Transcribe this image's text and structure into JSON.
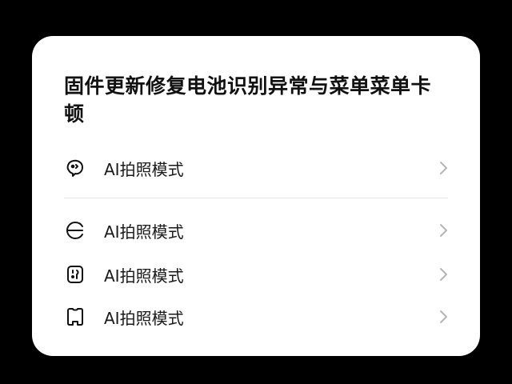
{
  "card": {
    "title": "固件更新修复电池识别异常与菜单菜单卡顿",
    "items": [
      {
        "label": "AI拍照模式",
        "icon": "face-speech-icon"
      },
      {
        "label": "AI拍照模式",
        "icon": "camera-mode-icon"
      },
      {
        "label": "AI拍照模式",
        "icon": "square-face-icon"
      },
      {
        "label": "AI拍照模式",
        "icon": "phone-frame-icon"
      }
    ]
  },
  "colors": {
    "background": "#000000",
    "card": "#ffffff",
    "text": "#111111",
    "chevron": "#b5b5b5",
    "divider": "#e6e6e6"
  }
}
